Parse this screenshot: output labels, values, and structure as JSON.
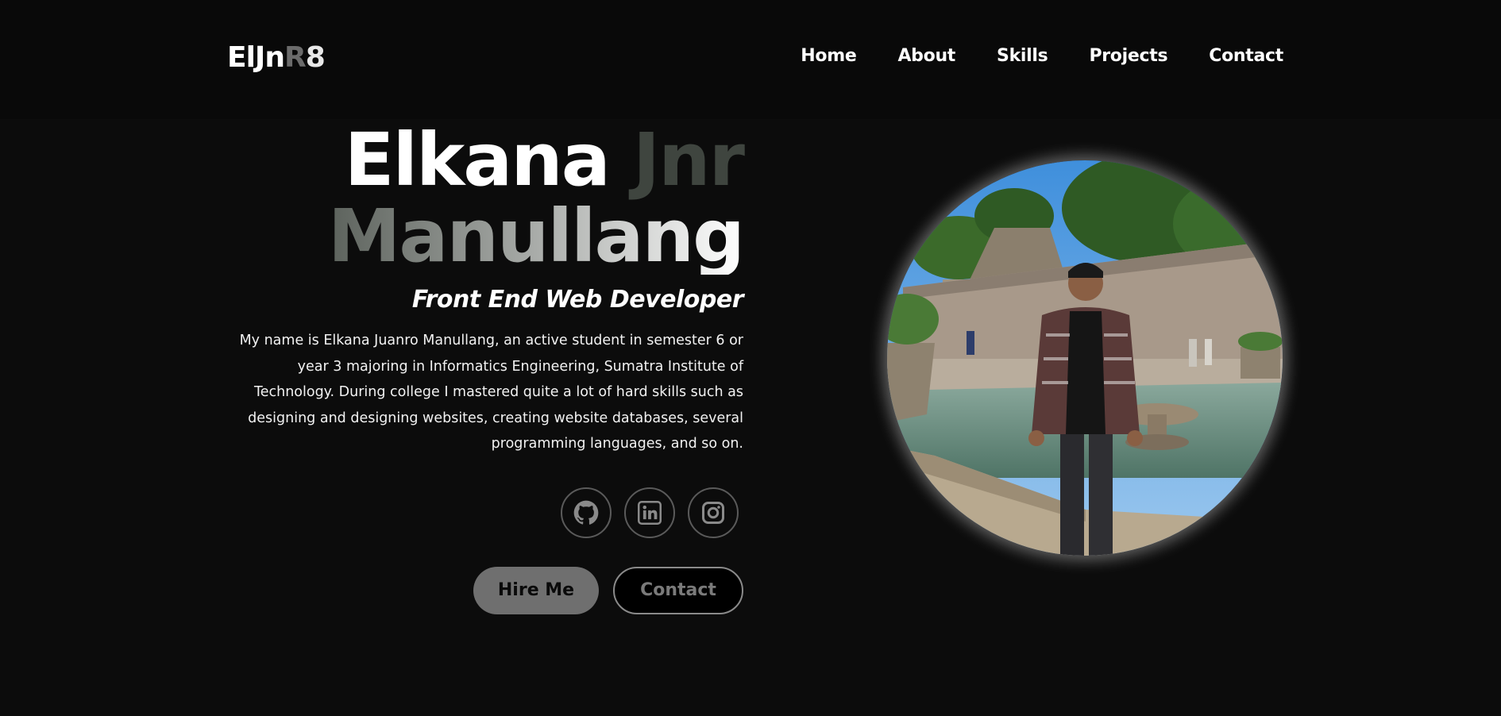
{
  "logo": {
    "part1": "ElJn",
    "part2": "R",
    "part3": "8"
  },
  "nav": {
    "items": [
      {
        "label": "Home"
      },
      {
        "label": "About"
      },
      {
        "label": "Skills"
      },
      {
        "label": "Projects"
      },
      {
        "label": "Contact"
      }
    ]
  },
  "hero": {
    "first_name": "Elkana",
    "middle_name": "Jnr",
    "last_name": "Manullang",
    "role": "Front End Web Developer",
    "bio": "My name is Elkana Juanro Manullang, an active student in semester 6 or year 3 majoring in Informatics Engineering, Sumatra Institute of Technology. During college I mastered quite a lot of hard skills such as designing and designing websites, creating website databases, several programming languages, and so on.",
    "socials": [
      {
        "icon": "github-icon"
      },
      {
        "icon": "linkedin-icon"
      },
      {
        "icon": "instagram-icon"
      }
    ],
    "hire_label": "Hire Me",
    "contact_label": "Contact"
  },
  "colors": {
    "background": "#0c0c0c",
    "navbar": "#090909",
    "accent_dark": "#3f453f",
    "hire_button": "#6f6f6f"
  }
}
